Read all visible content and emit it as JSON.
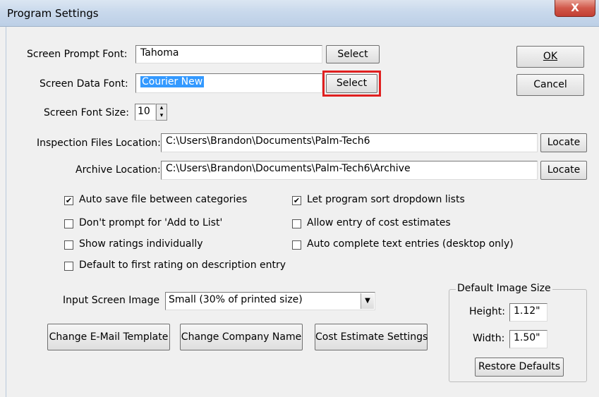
{
  "window": {
    "title": "Program Settings",
    "close_glyph": "X"
  },
  "fonts": {
    "prompt_label": "Screen Prompt Font:",
    "prompt_value": "Tahoma",
    "data_label": "Screen Data Font:",
    "data_value": "Courier New",
    "size_label": "Screen Font Size:",
    "size_value": "10",
    "select_label": "Select"
  },
  "locations": {
    "inspection_label": "Inspection Files Location:",
    "inspection_value": "C:\\Users\\Brandon\\Documents\\Palm-Tech6",
    "archive_label": "Archive Location:",
    "archive_value": "C:\\Users\\Brandon\\Documents\\Palm-Tech6\\Archive",
    "locate_label": "Locate"
  },
  "dialog_buttons": {
    "ok": "OK",
    "cancel": "Cancel"
  },
  "options_left": [
    {
      "label": "Auto save file between categories",
      "checked": true
    },
    {
      "label": "Don't prompt for 'Add to List'",
      "checked": false
    },
    {
      "label": "Show ratings individually",
      "checked": false
    },
    {
      "label": "Default to first rating on description entry",
      "checked": false
    }
  ],
  "options_right": [
    {
      "label": "Let program sort dropdown lists",
      "checked": true
    },
    {
      "label": "Allow entry of cost estimates",
      "checked": false
    },
    {
      "label": "Auto complete text entries (desktop only)",
      "checked": false
    }
  ],
  "image": {
    "input_label": "Input Screen Image",
    "input_value": "Small (30% of printed size)",
    "group_title": "Default Image Size",
    "height_label": "Height:",
    "height_value": "1.12\"",
    "width_label": "Width:",
    "width_value": "1.50\"",
    "restore_label": "Restore Defaults"
  },
  "bottom_buttons": {
    "email": "Change E-Mail Template",
    "company": "Change Company Name",
    "cost": "Cost Estimate Settings"
  },
  "icons": {
    "check": "✔",
    "dropdown": "▼",
    "spin_up": "▴",
    "spin_down": "▾"
  }
}
